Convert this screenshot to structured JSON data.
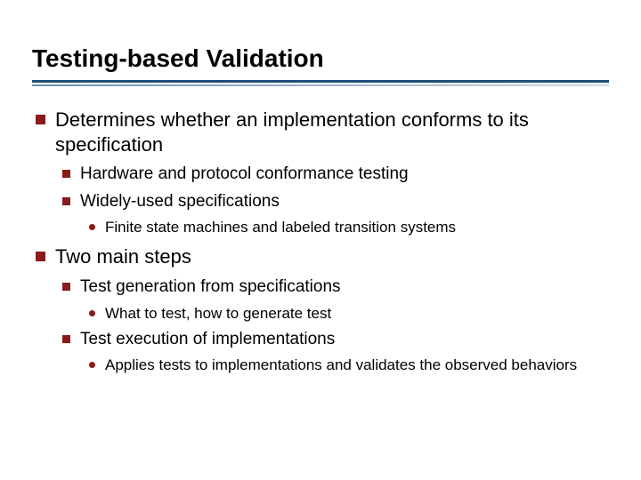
{
  "title": "Testing-based Validation",
  "bullets": [
    {
      "text": "Determines whether an implementation conforms to its specification",
      "children": [
        {
          "text": "Hardware and protocol conformance testing"
        },
        {
          "text": "Widely-used specifications",
          "children": [
            {
              "text": "Finite state machines and labeled transition systems"
            }
          ]
        }
      ]
    },
    {
      "text": "Two main steps",
      "children": [
        {
          "text": "Test generation from specifications",
          "children": [
            {
              "text": "What to test, how to generate test"
            }
          ]
        },
        {
          "text": "Test execution of implementations",
          "children": [
            {
              "text": "Applies tests to implementations and validates the observed behaviors"
            }
          ]
        }
      ]
    }
  ]
}
